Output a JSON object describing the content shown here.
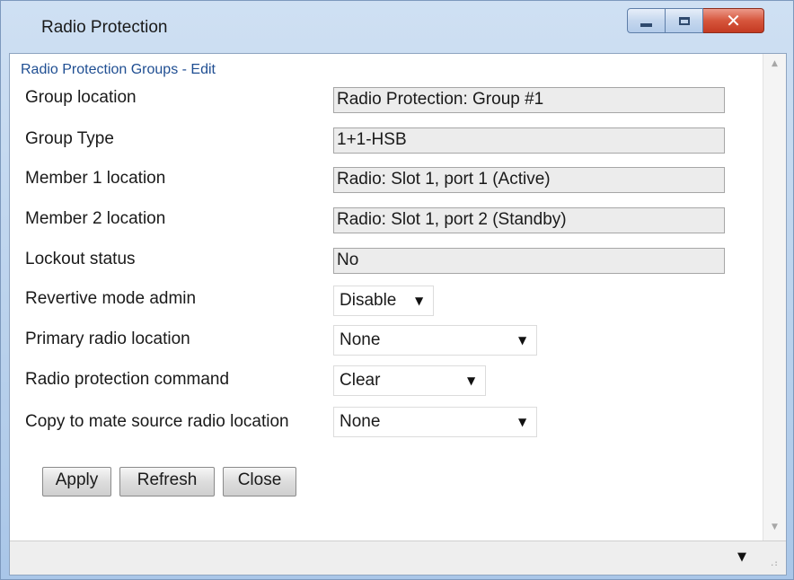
{
  "window": {
    "title": "Radio Protection"
  },
  "section_title": "Radio Protection Groups - Edit",
  "fields": [
    {
      "label": "Group location",
      "value": "Radio Protection: Group #1"
    },
    {
      "label": "Group Type",
      "value": "1+1-HSB"
    },
    {
      "label": "Member 1 location",
      "value": "Radio: Slot 1, port 1 (Active)"
    },
    {
      "label": "Member 2 location",
      "value": "Radio: Slot 1, port 2 (Standby)"
    },
    {
      "label": "Lockout status",
      "value": "No"
    }
  ],
  "selects": [
    {
      "label": "Revertive mode admin",
      "value": "Disable"
    },
    {
      "label": "Primary radio location",
      "value": "None"
    },
    {
      "label": "Radio protection command",
      "value": "Clear"
    },
    {
      "label": "Copy to mate source radio location",
      "value": "None"
    }
  ],
  "buttons": {
    "apply": "Apply",
    "refresh": "Refresh",
    "close": "Close"
  },
  "icons": {
    "minimize": "minimize-icon",
    "maximize": "maximize-icon",
    "close": "close-icon",
    "dropdown": "chevron-down-icon"
  },
  "colors": {
    "section_title": "#1f4e92",
    "close_button": "#d6553c",
    "readonly_field": "#ececec"
  }
}
